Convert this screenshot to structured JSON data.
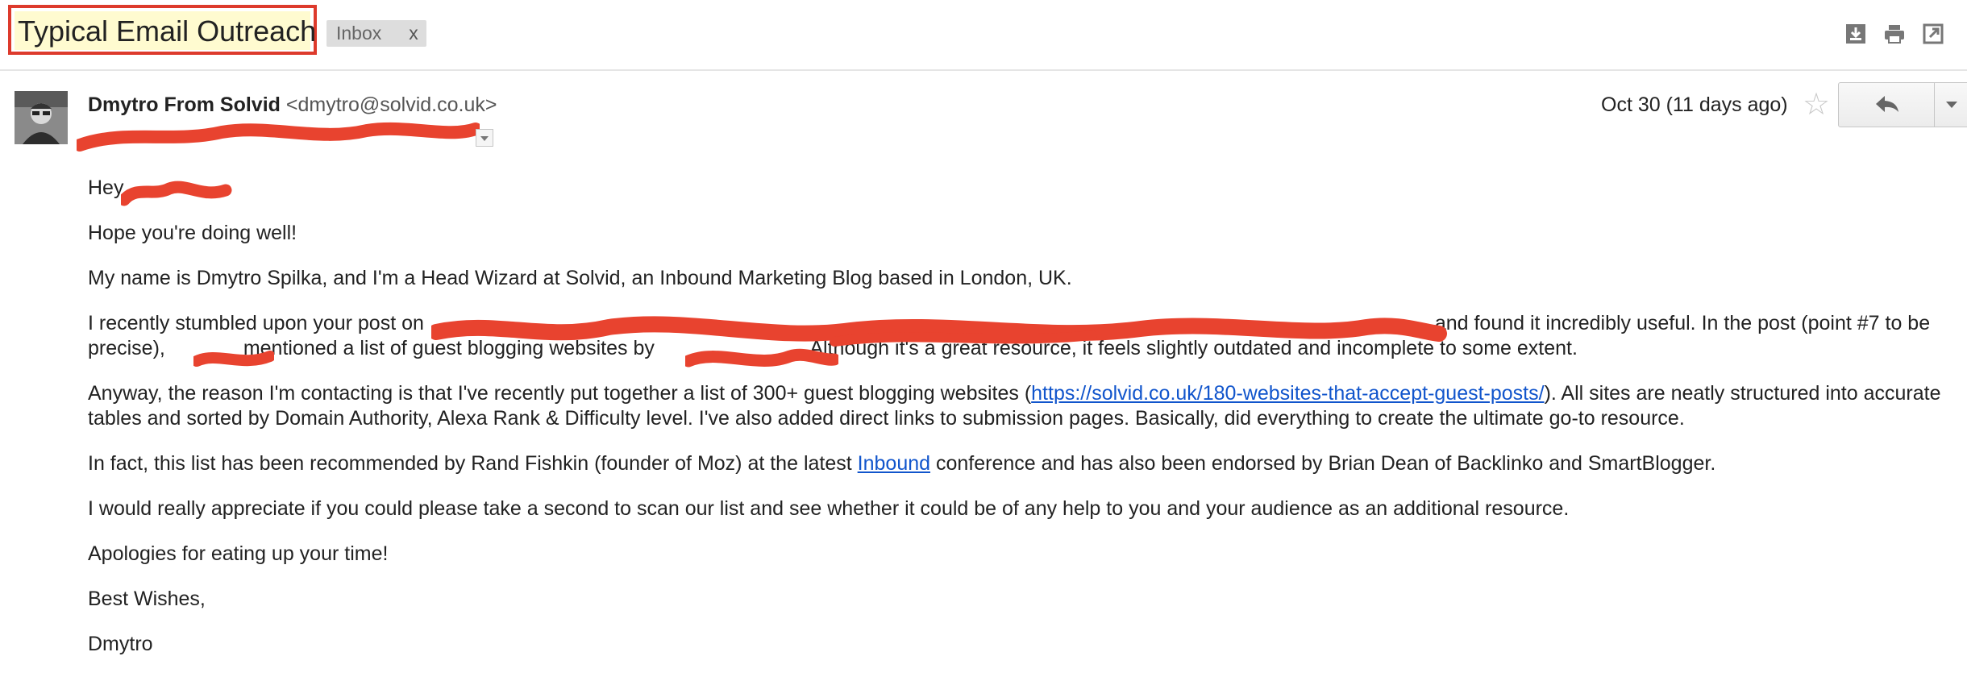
{
  "header": {
    "subject": "Typical Email Outreach",
    "label": "Inbox",
    "label_remove": "x",
    "icons": [
      "download-icon",
      "print-icon",
      "new-window-icon"
    ]
  },
  "message": {
    "sender_name": "Dmytro From Solvid",
    "sender_email": "<dmytro@solvid.co.uk>",
    "date": "Oct 30 (11 days ago)"
  },
  "body": {
    "greeting": "Hey",
    "greeting_end": ",",
    "p1": "Hope you're doing well!",
    "p2": "My name is Dmytro Spilka, and I'm a Head Wizard at Solvid, an Inbound Marketing Blog based in London, UK.",
    "p3_a": "I recently stumbled upon your post on",
    "p3_b": ", and found it incredibly useful. In the post (point #7 to be precise),",
    "p3_c": "mentioned a list of guest blogging websites by",
    "p3_d": ". Although it's a great resource, it feels slightly outdated and incomplete to some extent.",
    "p4_a": "Anyway, the reason I'm contacting is that I've recently put together a list of 300+ guest blogging websites (",
    "p4_link": "https://solvid.co.uk/180-websites-that-accept-guest-posts/",
    "p4_b": "). All sites are neatly structured into accurate tables and sorted by Domain Authority, Alexa Rank & Difficulty level. I've also added direct links to submission pages. Basically, did everything to create the ultimate go-to resource.",
    "p5_a": "In fact, this list has been recommended by Rand Fishkin (founder of Moz) at the latest",
    "p5_link": "Inbound",
    "p5_b": "conference and has also been endorsed by Brian Dean of Backlinko and SmartBlogger.",
    "p6": "I would really appreciate if you could please take a second to scan our list and see whether it could be of any help to you and your audience as an additional resource.",
    "p7": "Apologies for eating up your time!",
    "p8": "Best Wishes,",
    "p9": "Dmytro"
  },
  "colors": {
    "redaction": "#e8432f",
    "highlight_border": "#dd3a2c",
    "link": "#1155cc"
  }
}
